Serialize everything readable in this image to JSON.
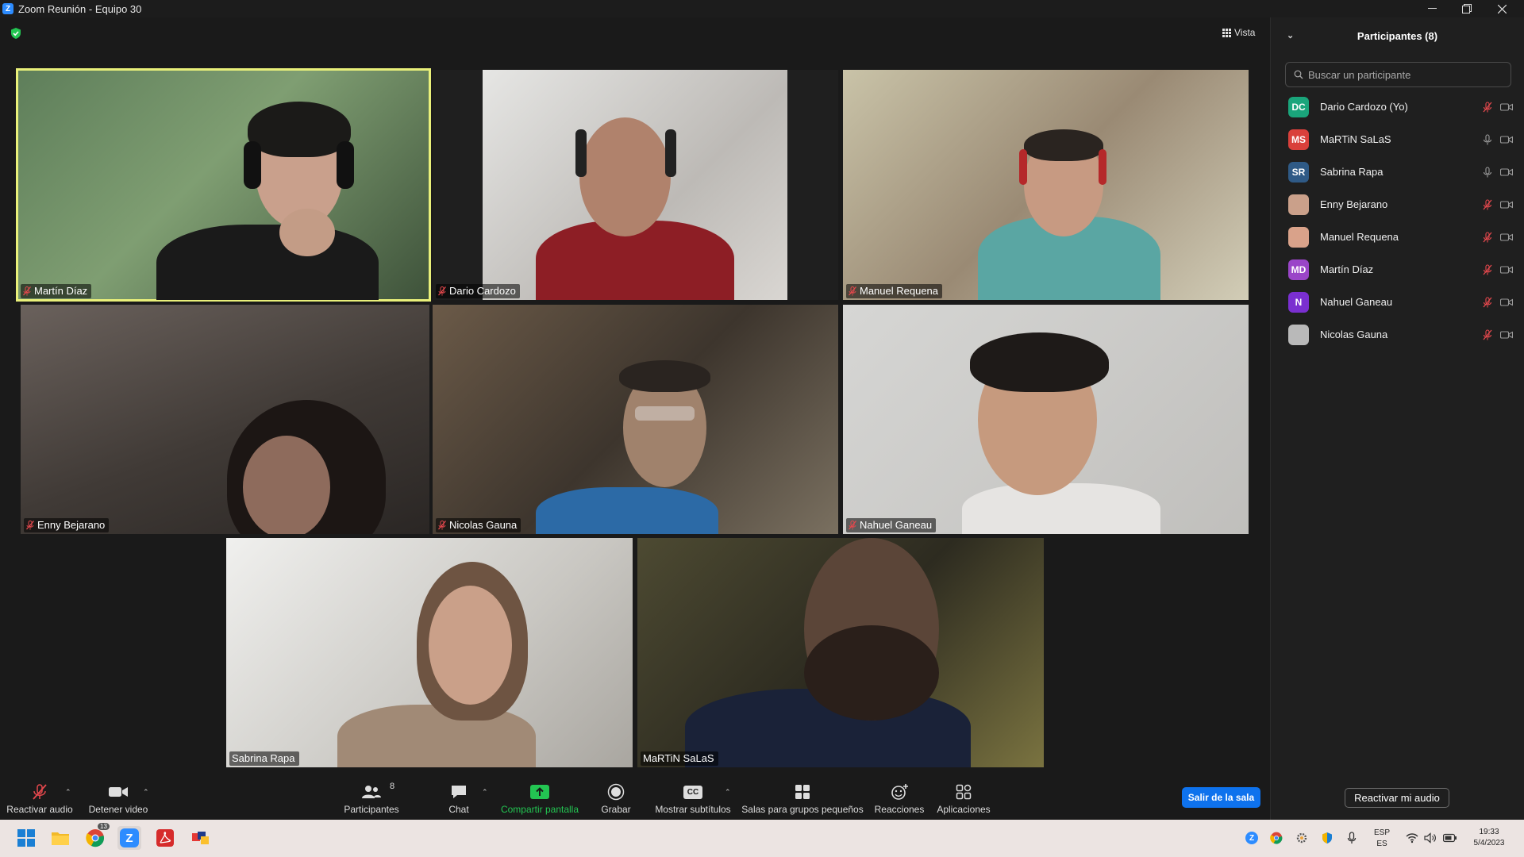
{
  "window": {
    "title": "Zoom Reunión - Equipo 30",
    "logo_letter": "Z"
  },
  "view_button": {
    "label": "Vista"
  },
  "tiles": [
    {
      "name": "Martín Díaz",
      "muted": true,
      "active": true
    },
    {
      "name": "Dario Cardozo",
      "muted": true
    },
    {
      "name": "Manuel Requena",
      "muted": true
    },
    {
      "name": "Enny Bejarano",
      "muted": true
    },
    {
      "name": "Nicolas Gauna",
      "muted": true
    },
    {
      "name": "Nahuel Ganeau",
      "muted": true
    },
    {
      "name": "Sabrina Rapa",
      "muted": false
    },
    {
      "name": "MaRTiN SaLaS",
      "muted": false
    }
  ],
  "panel": {
    "title": "Participantes (8)",
    "search_placeholder": "Buscar un participante",
    "participants": [
      {
        "initials": "DC",
        "name": "Dario Cardozo (Yo)",
        "color": "#1aa57b",
        "muted": true
      },
      {
        "initials": "MS",
        "name": "MaRTiN SaLaS",
        "color": "#d9403b",
        "muted": false
      },
      {
        "initials": "SR",
        "name": "Sabrina Rapa",
        "color": "#2f5a86",
        "muted": false
      },
      {
        "initials": "",
        "name": "Enny Bejarano",
        "color": "#caa08a",
        "muted": true
      },
      {
        "initials": "",
        "name": "Manuel Requena",
        "color": "#d9a28a",
        "muted": true
      },
      {
        "initials": "MD",
        "name": "Martín Díaz",
        "color": "#9a45c8",
        "muted": true
      },
      {
        "initials": "N",
        "name": "Nahuel Ganeau",
        "color": "#7a2fd0",
        "muted": true
      },
      {
        "initials": "",
        "name": "Nicolas Gauna",
        "color": "#b9b9b9",
        "muted": true
      }
    ],
    "reactivate_label": "Reactivar mi audio"
  },
  "toolbar": {
    "unmute": "Reactivar audio",
    "stop_video": "Detener video",
    "participants": "Participantes",
    "participants_count": "8",
    "chat": "Chat",
    "share": "Compartir pantalla",
    "record": "Grabar",
    "captions": "Mostrar subtítulos",
    "breakout": "Salas para grupos pequeños",
    "reactions": "Reacciones",
    "apps": "Aplicaciones",
    "leave": "Salir de la sala",
    "cc_text": "CC"
  },
  "taskbar": {
    "lang_top": "ESP",
    "lang_bottom": "ES",
    "time": "19:33",
    "date": "5/4/2023",
    "chrome_badge": "13"
  }
}
